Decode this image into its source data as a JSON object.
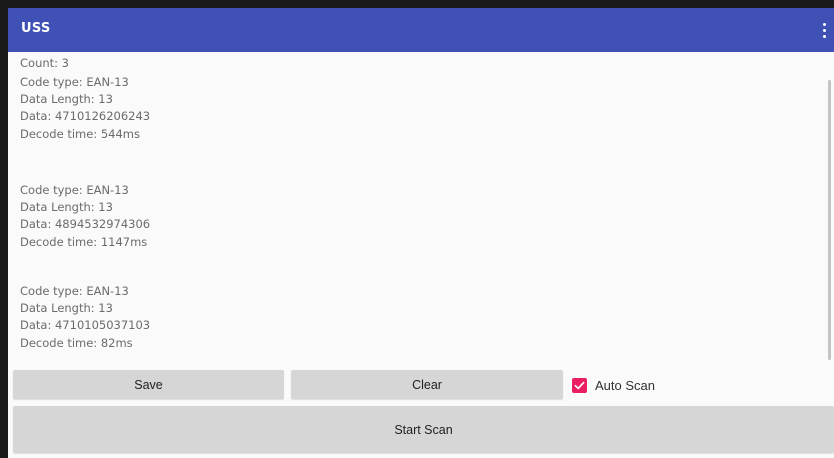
{
  "appbar": {
    "title": "USS",
    "menu_icon": "more-vert-icon",
    "background": "#3f51b5"
  },
  "log": {
    "count_label": "Count:  3",
    "entries": [
      {
        "code_type": "Code type: EAN-13",
        "data_length": "Data Length: 13",
        "data": "Data: 4710126206243",
        "decode_time": "Decode time: 544ms"
      },
      {
        "code_type": "Code type: EAN-13",
        "data_length": "Data Length: 13",
        "data": "Data: 4894532974306",
        "decode_time": "Decode time: 1147ms"
      },
      {
        "code_type": "Code type: EAN-13",
        "data_length": "Data Length: 13",
        "data": "Data: 4710105037103",
        "decode_time": "Decode time: 82ms"
      }
    ]
  },
  "controls": {
    "save_label": "Save",
    "clear_label": "Clear",
    "auto_scan_label": "Auto Scan",
    "auto_scan_checked": true,
    "start_scan_label": "Start Scan",
    "accent": "#e91e63"
  }
}
